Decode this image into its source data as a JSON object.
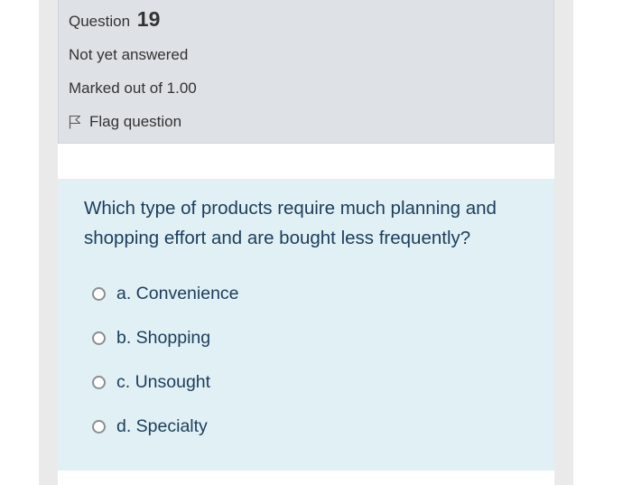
{
  "question_info": {
    "heading_label": "Question",
    "number": "19",
    "state": "Not yet answered",
    "grade": "Marked out of 1.00",
    "flag_label": "Flag question",
    "flag_icon": "flag-icon"
  },
  "question": {
    "text": "Which type of products require much planning and shopping effort and are bought less frequently?",
    "answers": [
      {
        "label": "a. Convenience",
        "selected": false
      },
      {
        "label": "b. Shopping",
        "selected": false
      },
      {
        "label": "c. Unsought",
        "selected": false
      },
      {
        "label": "d. Specialty",
        "selected": false
      }
    ]
  },
  "colors": {
    "info_background": "#dee2e6",
    "question_background": "#e0f0f5",
    "question_text": "#1c3d5a",
    "info_text": "#333333"
  }
}
